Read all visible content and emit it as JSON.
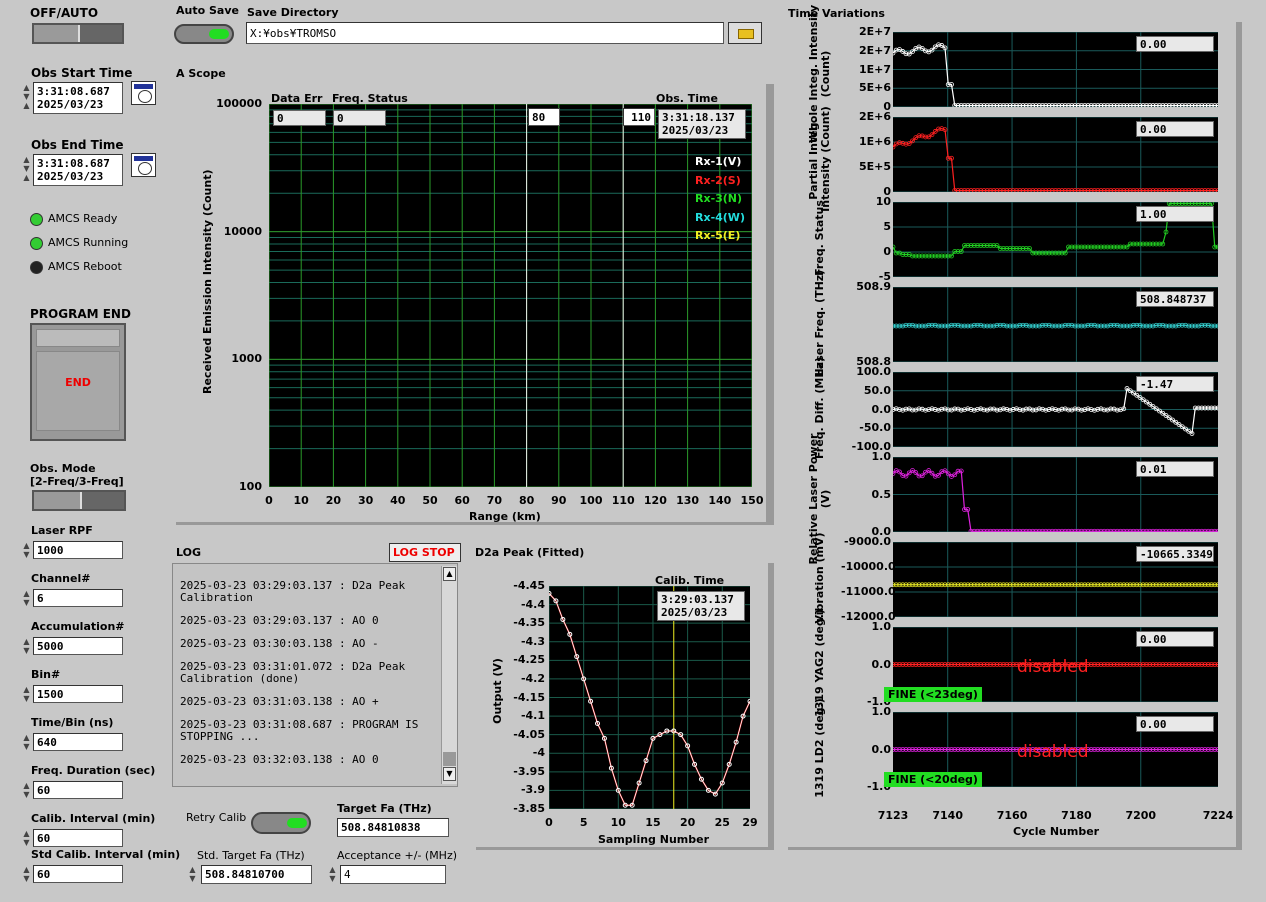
{
  "left": {
    "off_auto_label": "OFF/AUTO",
    "obs_start_label": "Obs Start Time",
    "obs_start_time": "3:31:08.687",
    "obs_start_date": "2025/03/23",
    "obs_end_label": "Obs End Time",
    "obs_end_time": "3:31:08.687",
    "obs_end_date": "2025/03/23",
    "leds": [
      {
        "label": "AMCS Ready",
        "color": "#33cc33"
      },
      {
        "label": "AMCS Running",
        "color": "#33cc33"
      },
      {
        "label": "AMCS Reboot",
        "color": "#222222"
      }
    ],
    "program_end_label": "PROGRAM END",
    "end_button": "END",
    "obs_mode_label": "Obs. Mode",
    "obs_mode_sub": "[2-Freq/3-Freq]",
    "laser_rpf_label": "Laser RPF",
    "laser_rpf": "1000",
    "channel_label": "Channel#",
    "channel": "6",
    "accum_label": "Accumulation#",
    "accum": "5000",
    "bin_label": "Bin#",
    "bin": "1500",
    "timebin_label": "Time/Bin (ns)",
    "timebin": "640",
    "freqdur_label": "Freq. Duration (sec)",
    "freqdur": "60",
    "calib_label": "Calib. Interval (min)",
    "calib": "60",
    "stdcalib_label": "Std Calib. Interval (min)",
    "stdcalib": "60"
  },
  "top": {
    "autosave_label": "Auto Save",
    "savedir_label": "Save Directory",
    "savedir": "X:¥obs¥TROMSO",
    "folder_icon": "folder-icon"
  },
  "scope": {
    "title": "A Scope",
    "data_err_label": "Data Err",
    "data_err": "0",
    "freq_status_label": "Freq. Status",
    "freq_status": "0",
    "cursor1": "80",
    "cursor2": "110",
    "obs_time_label": "Obs. Time",
    "obs_time": "3:31:18.137",
    "obs_date": "2025/03/23",
    "legend": [
      {
        "name": "Rx-1(V)",
        "color": "#ffffff"
      },
      {
        "name": "Rx-2(S)",
        "color": "#ff2020"
      },
      {
        "name": "Rx-3(N)",
        "color": "#22dd22"
      },
      {
        "name": "Rx-4(W)",
        "color": "#22dddd"
      },
      {
        "name": "Rx-5(E)",
        "color": "#eeee22"
      }
    ],
    "ylabel": "Received Emission Intensity (Count)",
    "xlabel": "Range (km)",
    "yticks": [
      "100000",
      "10000",
      "1000",
      "100"
    ],
    "xticks": [
      "0",
      "10",
      "20",
      "30",
      "40",
      "50",
      "60",
      "70",
      "80",
      "90",
      "100",
      "110",
      "120",
      "130",
      "140",
      "150"
    ]
  },
  "log": {
    "title": "LOG",
    "stop_button": "LOG STOP",
    "entries": [
      "2025-03-23 03:29:03.137 : D2a Peak Calibration",
      "2025-03-23 03:29:03.137 : AO 0",
      "2025-03-23 03:30:03.138 : AO -",
      "2025-03-23 03:31:01.072 : D2a Peak Calibration (done)",
      "2025-03-23 03:31:03.138 : AO +",
      "2025-03-23 03:31:08.687 : PROGRAM IS STOPPING ...",
      "2025-03-23 03:32:03.138 : AO 0"
    ]
  },
  "bottom": {
    "retry_label": "Retry Calib",
    "target_label": "Target Fa (THz)",
    "target": "508.84810838",
    "std_target_label": "Std. Target Fa (THz)",
    "std_target": "508.84810700",
    "accept_label": "Acceptance +/- (MHz)",
    "accept": "4"
  },
  "d2a": {
    "title": "D2a Peak (Fitted)",
    "calib_time_label": "Calib. Time",
    "calib_time": "3:29:03.137",
    "calib_date": "2025/03/23",
    "ylabel": "Output (V)",
    "xlabel": "Sampling Number",
    "yticks": [
      "-4.45",
      "-4.4",
      "-4.35",
      "-4.3",
      "-4.25",
      "-4.2",
      "-4.15",
      "-4.1",
      "-4.05",
      "-4",
      "-3.95",
      "-3.9",
      "-3.85"
    ],
    "xticks": [
      "0",
      "5",
      "10",
      "15",
      "20",
      "25",
      "29"
    ]
  },
  "tv": {
    "title": "Time Variations",
    "xlabel": "Cycle Number",
    "xticks": [
      "7123",
      "7140",
      "7160",
      "7180",
      "7200",
      "7224"
    ],
    "panels": [
      {
        "ylabel": "Whole Integ. Intensity (Count)",
        "yticks": [
          "2E+7",
          "2E+7",
          "1E+7",
          "5E+6",
          "0"
        ],
        "value": "0.00",
        "color": "#ffffff"
      },
      {
        "ylabel": "Partial Integ. Intensity (Count)",
        "yticks": [
          "2E+6",
          "1E+6",
          "5E+5",
          "0"
        ],
        "value": "0.00",
        "color": "#ff2020"
      },
      {
        "ylabel": "Freq. Status",
        "yticks": [
          "10",
          "5",
          "0",
          "-5"
        ],
        "value": "1.00",
        "color": "#22cc22"
      },
      {
        "ylabel": "Laser Freq. (THz)",
        "yticks": [
          "508.9",
          "508.8"
        ],
        "value": "508.848737",
        "color": "#33cccc"
      },
      {
        "ylabel": "Freq. Diff. (MHz)",
        "yticks": [
          "100.0",
          "50.0",
          "0.0",
          "-50.0",
          "-100.0"
        ],
        "value": "-1.47",
        "color": "#ffffff"
      },
      {
        "ylabel": "Relative Laser Power (V)",
        "yticks": [
          "1.0",
          "0.5",
          "0.0"
        ],
        "value": "0.01",
        "color": "#dd22dd"
      },
      {
        "ylabel": "Vibration (mV)",
        "yticks": [
          "-9000.0",
          "-10000.0",
          "-11000.0",
          "-12000.0"
        ],
        "value": "-10665.3349",
        "color": "#dddd22"
      },
      {
        "ylabel": "1319 YAG2 (deg.)",
        "yticks": [
          "1.0",
          "0.0",
          "-1.0"
        ],
        "value": "0.00",
        "color": "#ff2020",
        "disabled": "disabled",
        "fine": "FINE (<23deg)"
      },
      {
        "ylabel": "1319 LD2 (deg.)",
        "yticks": [
          "1.0",
          "0.0",
          "-1.0"
        ],
        "value": "0.00",
        "color": "#dd22dd",
        "disabled": "disabled",
        "fine": "FINE (<20deg)"
      }
    ]
  }
}
